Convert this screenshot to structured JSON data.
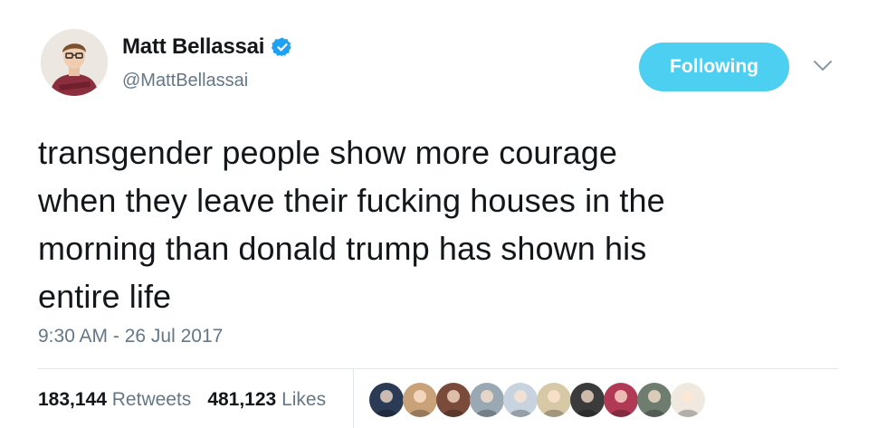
{
  "author": {
    "name": "Matt Bellassai",
    "handle": "@MattBellassai",
    "verified": true,
    "avatar_icon": "profile-photo"
  },
  "follow_button": {
    "label": "Following",
    "color": "#4ccff0"
  },
  "menu_icon": "chevron-down-icon",
  "tweet": {
    "lines": [
      "transgender people show more courage",
      "when they leave their fucking houses in the",
      "morning than donald trump has shown his",
      "entire life"
    ],
    "timestamp": "9:30 AM - 26 Jul 2017"
  },
  "stats": {
    "retweets_count": "183,144",
    "retweets_label": "Retweets",
    "likes_count": "481,123",
    "likes_label": "Likes"
  },
  "likers": [
    {
      "name": "liker-avatar-1",
      "bg": "#2b3a55"
    },
    {
      "name": "liker-avatar-2",
      "bg": "#c9a27a"
    },
    {
      "name": "liker-avatar-3",
      "bg": "#7a4a3a"
    },
    {
      "name": "liker-avatar-4",
      "bg": "#9aa8b4"
    },
    {
      "name": "liker-avatar-5",
      "bg": "#c7d3de"
    },
    {
      "name": "liker-avatar-6",
      "bg": "#d8c9a6"
    },
    {
      "name": "liker-avatar-7",
      "bg": "#3b3b3b"
    },
    {
      "name": "liker-avatar-8",
      "bg": "#b03a55"
    },
    {
      "name": "liker-avatar-9",
      "bg": "#6f7d70"
    },
    {
      "name": "liker-avatar-10",
      "bg": "#efe9df"
    }
  ]
}
